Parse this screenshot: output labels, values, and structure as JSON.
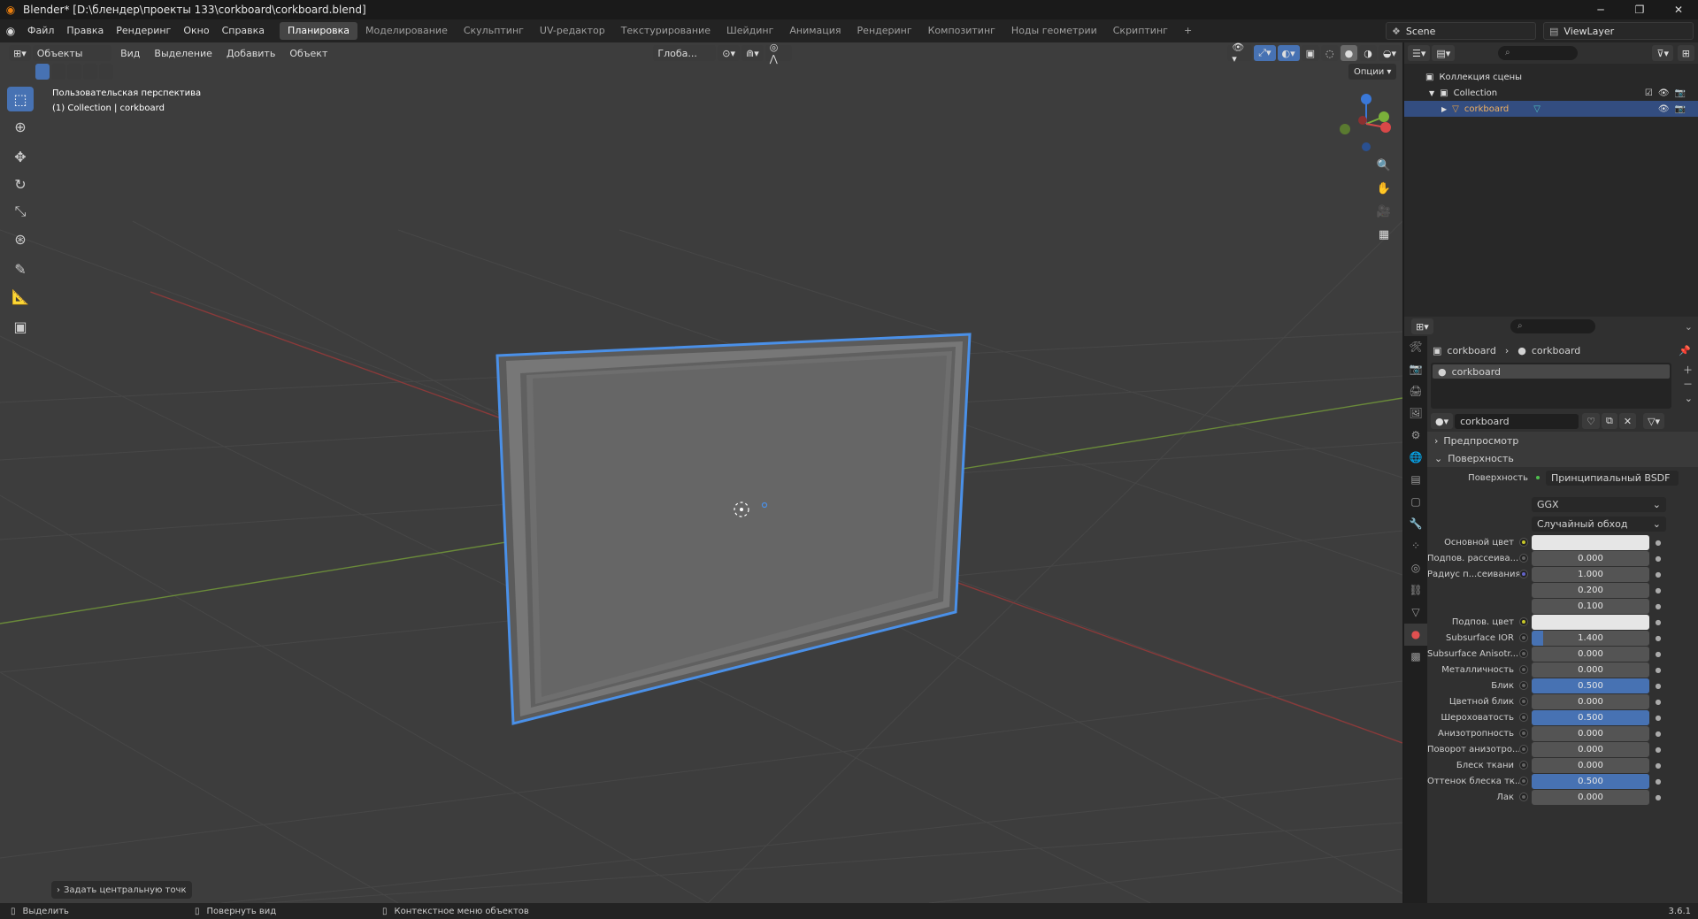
{
  "title": "Blender* [D:\\блендер\\проекты 133\\corkboard\\corkboard.blend]",
  "menu": [
    "Файл",
    "Правка",
    "Рендеринг",
    "Окно",
    "Справка"
  ],
  "workspaces": [
    "Планировка",
    "Моделирование",
    "Скульптинг",
    "UV-редактор",
    "Текстурирование",
    "Шейдинг",
    "Анимация",
    "Рендеринг",
    "Композитинг",
    "Ноды геометрии",
    "Скриптинг",
    "+"
  ],
  "scene": "Scene",
  "view_layer": "ViewLayer",
  "viewport": {
    "mode": "Объекты",
    "menus": [
      "Вид",
      "Выделение",
      "Добавить",
      "Объект"
    ],
    "transform_orientation": "Глоба...",
    "options": "Опции",
    "view_name": "Пользовательская перспектива",
    "collection_info": "(1) Collection | corkboard",
    "last_operator": "Задать центральную точк"
  },
  "outliner": {
    "scene_collection": "Коллекция сцены",
    "collection": "Collection",
    "object": "corkboard"
  },
  "properties": {
    "breadcrumb_object": "corkboard",
    "breadcrumb_material": "corkboard",
    "slot": "corkboard",
    "material": "corkboard",
    "preview": "Предпросмотр",
    "surface_panel": "Поверхность",
    "surface_label": "Поверхность",
    "surface_shader": "Принципиальный BSDF",
    "distribution": "GGX",
    "subsurface_method": "Случайный обход",
    "rows": [
      {
        "label": "Основной цвет",
        "value": "",
        "socket": "y",
        "fill": 0,
        "color": true
      },
      {
        "label": "Подпов. рассеива...",
        "value": "0.000",
        "socket": "v",
        "fill": 0
      },
      {
        "label": "Радиус п...сеивания",
        "value": "1.000",
        "socket": "b",
        "fill": 0
      },
      {
        "label": "",
        "value": "0.200",
        "socket": "",
        "fill": 0
      },
      {
        "label": "",
        "value": "0.100",
        "socket": "",
        "fill": 0
      },
      {
        "label": "Подпов. цвет",
        "value": "",
        "socket": "y",
        "fill": 0,
        "color": true
      },
      {
        "label": "Subsurface IOR",
        "value": "1.400",
        "socket": "v",
        "fill": 0.1
      },
      {
        "label": "Subsurface Anisotr...",
        "value": "0.000",
        "socket": "v",
        "fill": 0
      },
      {
        "label": "Металличность",
        "value": "0.000",
        "socket": "v",
        "fill": 0
      },
      {
        "label": "Блик",
        "value": "0.500",
        "socket": "v",
        "fill": 1
      },
      {
        "label": "Цветной блик",
        "value": "0.000",
        "socket": "v",
        "fill": 0
      },
      {
        "label": "Шероховатость",
        "value": "0.500",
        "socket": "v",
        "fill": 1
      },
      {
        "label": "Анизотропность",
        "value": "0.000",
        "socket": "v",
        "fill": 0
      },
      {
        "label": "Поворот анизотро...",
        "value": "0.000",
        "socket": "v",
        "fill": 0
      },
      {
        "label": "Блеск ткани",
        "value": "0.000",
        "socket": "v",
        "fill": 0
      },
      {
        "label": "Оттенок блеска тк...",
        "value": "0.500",
        "socket": "v",
        "fill": 1
      },
      {
        "label": "Лак",
        "value": "0.000",
        "socket": "v",
        "fill": 0
      }
    ]
  },
  "status": {
    "select": "Выделить",
    "rotate": "Повернуть вид",
    "context": "Контекстное меню объектов",
    "version": "3.6.1"
  }
}
